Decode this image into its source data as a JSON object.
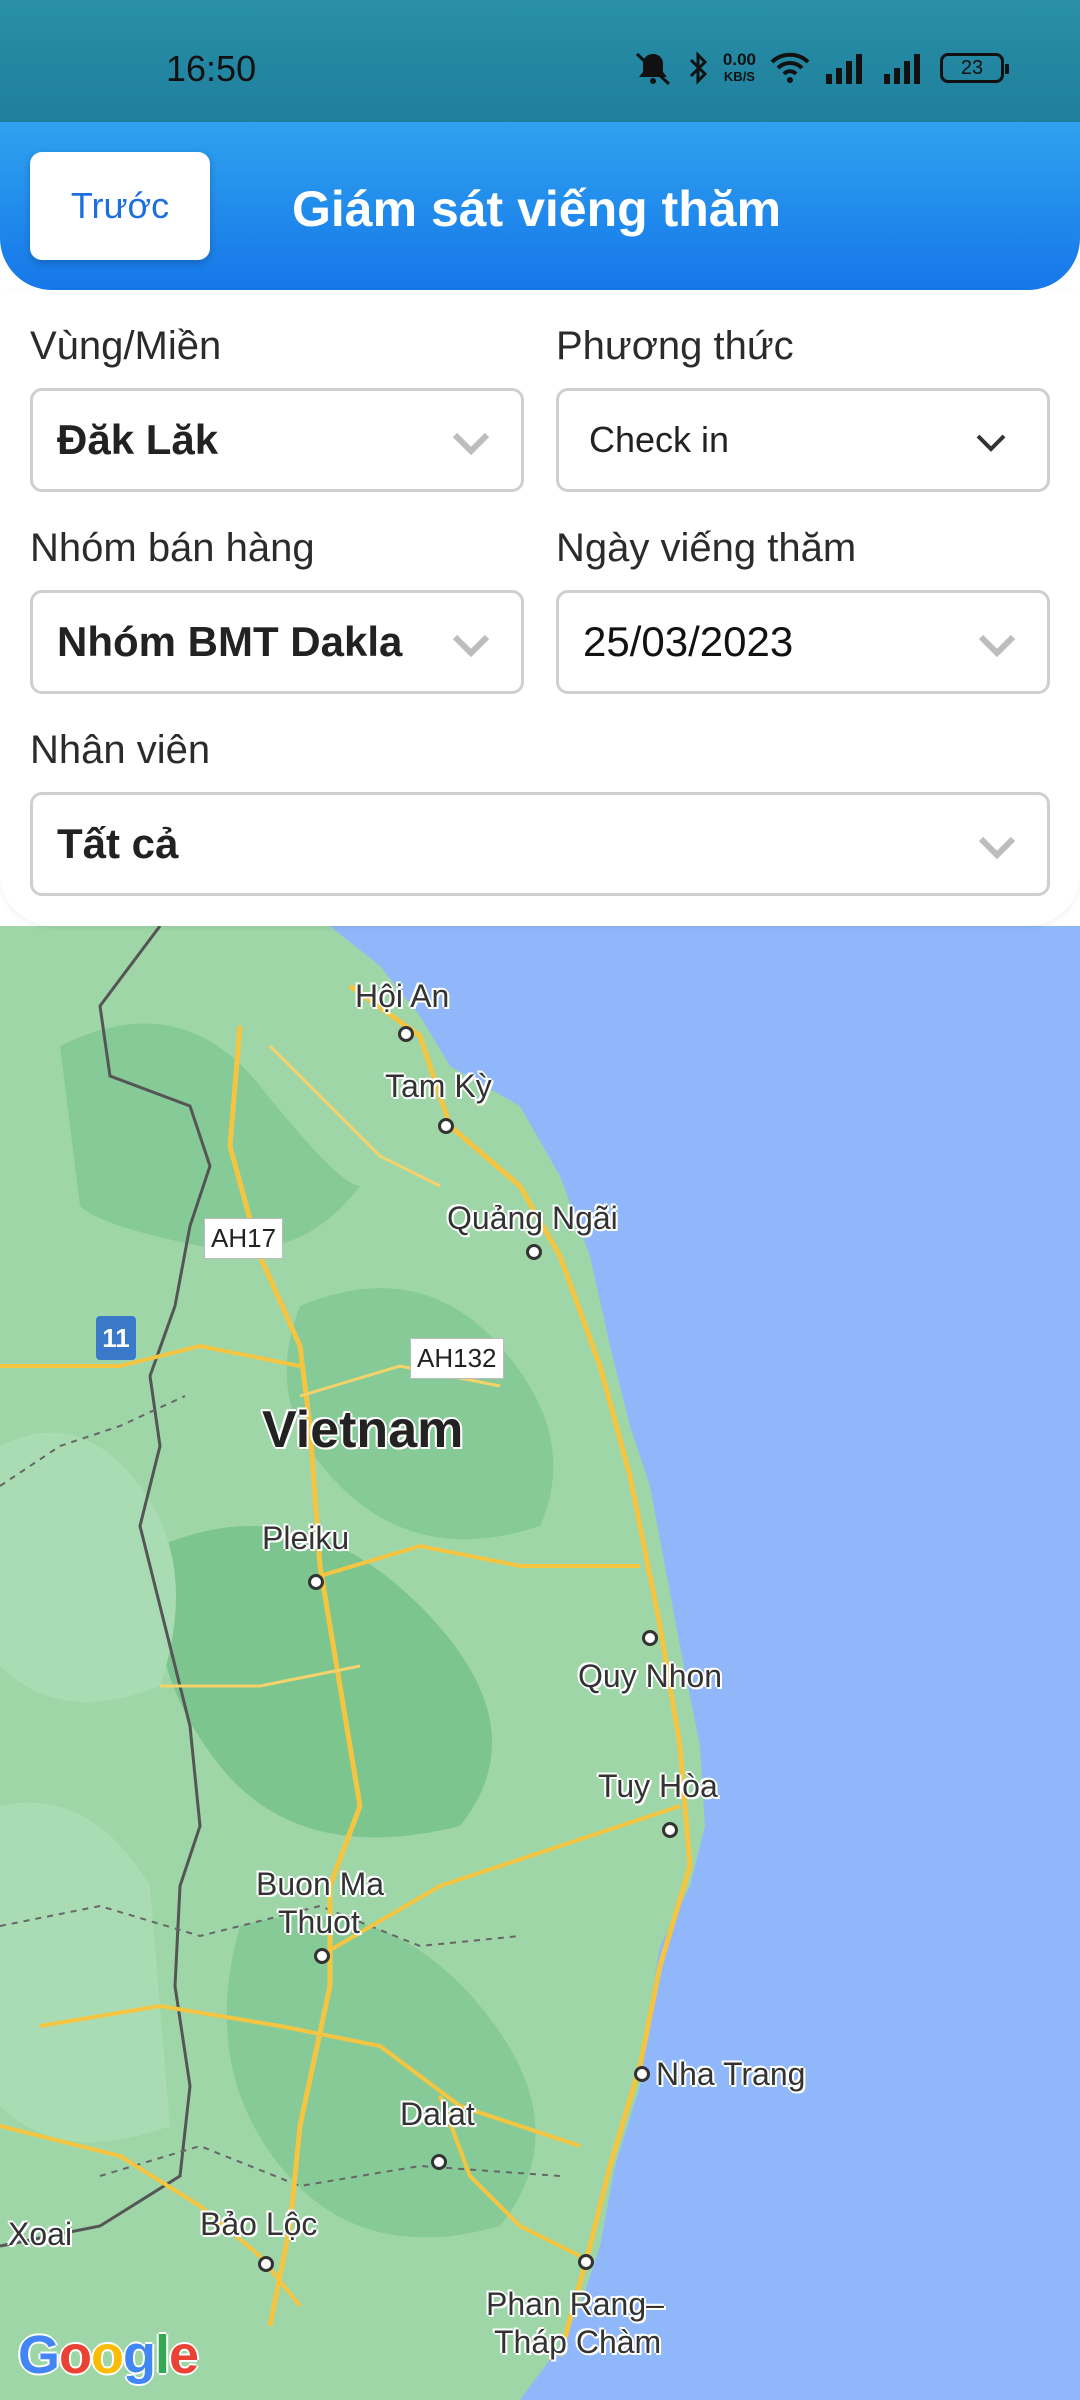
{
  "status_bar": {
    "time": "16:50",
    "net_speed_top": "0.00",
    "net_speed_unit": "KB/S",
    "battery": "23"
  },
  "header": {
    "back_label": "Trước",
    "title": "Giám sát viếng thăm"
  },
  "filters": {
    "region_label": "Vùng/Miền",
    "region_value": "Đăk Lăk",
    "method_label": "Phương thức",
    "method_value": "Check in",
    "group_label": "Nhóm bán hàng",
    "group_value": "Nhóm BMT Dakla",
    "date_label": "Ngày viếng thăm",
    "date_value": "25/03/2023",
    "staff_label": "Nhân viên",
    "staff_value": "Tất cả"
  },
  "map": {
    "country": "Vietnam",
    "cities": [
      "Hội An",
      "Tam Kỳ",
      "Quảng Ngãi",
      "Pleiku",
      "Quy Nhon",
      "Tuy Hòa",
      "Buon Ma",
      "Thuot",
      "Nha Trang",
      "Dalat",
      "Bảo Lộc",
      "Phan Rang–",
      "Tháp Chàm",
      "Xoai"
    ],
    "highways": [
      "AH17",
      "AH132"
    ],
    "route_number": "11",
    "attribution": "Google",
    "colors": {
      "land": "#9ed6a8",
      "land_dark": "#78c48c",
      "water": "#8fb7fa",
      "road": "#f5c542"
    }
  }
}
